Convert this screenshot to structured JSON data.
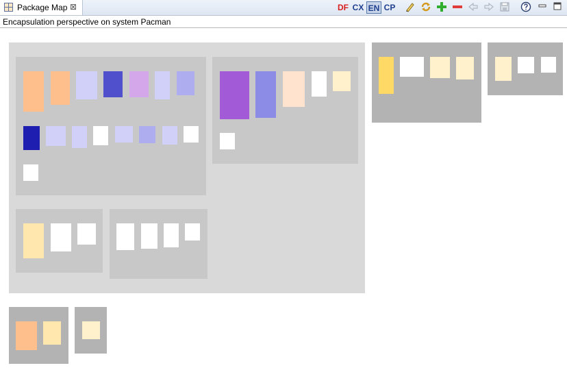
{
  "tab": {
    "title": "Package Map",
    "close_glyph": "⊠"
  },
  "toolbar": {
    "df_label": "DF",
    "cx_label": "CX",
    "en_label": "EN",
    "cp_label": "CP",
    "icons": [
      "pencil-icon",
      "refresh-icon",
      "plus-icon",
      "minus-icon",
      "back-arrow-icon",
      "forward-arrow-icon",
      "save-icon",
      "help-icon",
      "minimize-icon",
      "maximize-icon"
    ]
  },
  "subtitle": "Encapsulation perspective on system Pacman",
  "colors": {
    "outer_package": "#d9d9d9",
    "inner_package": "#c8c8c8",
    "dark_package": "#b3b3b3",
    "df_color": "#d91e1e",
    "toolbar_blue": "#1f3f8f",
    "class_palette": [
      "#ffbf8c",
      "#d0d0f8",
      "#5050cc",
      "#d4a6ea",
      "#adadf0",
      "#1e1eb0",
      "#a25ad6",
      "#8c8ce6",
      "#ffe3cf",
      "#fff1cc",
      "#ffe7ad",
      "#ffd966",
      "#ffffff"
    ]
  }
}
